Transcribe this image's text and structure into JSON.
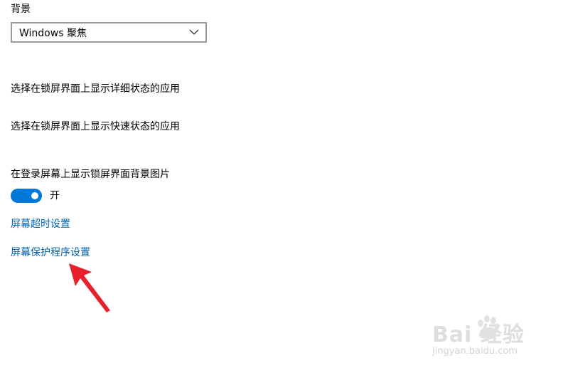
{
  "background": {
    "label": "背景",
    "dropdown_value": "Windows 聚焦"
  },
  "apps": {
    "detailed_status_label": "选择在锁屏界面上显示详细状态的应用",
    "quick_status_label": "选择在锁屏界面上显示快速状态的应用"
  },
  "signin": {
    "label": "在登录屏幕上显示锁屏界面背景图片",
    "toggle_on": true,
    "toggle_state_label": "开"
  },
  "links": {
    "screen_timeout": "屏幕超时设置",
    "screen_saver": "屏幕保护程序设置"
  },
  "watermark": {
    "brand": "Bai  经验",
    "url": "jingyan.baidu.com"
  },
  "colors": {
    "accent": "#0078d7",
    "link": "#0063b1",
    "annotation_arrow": "#e8202a"
  },
  "icons": {
    "dropdown": "chevron-down-icon",
    "annotation": "red-arrow-icon",
    "watermark": "baidu-paw-icon"
  }
}
